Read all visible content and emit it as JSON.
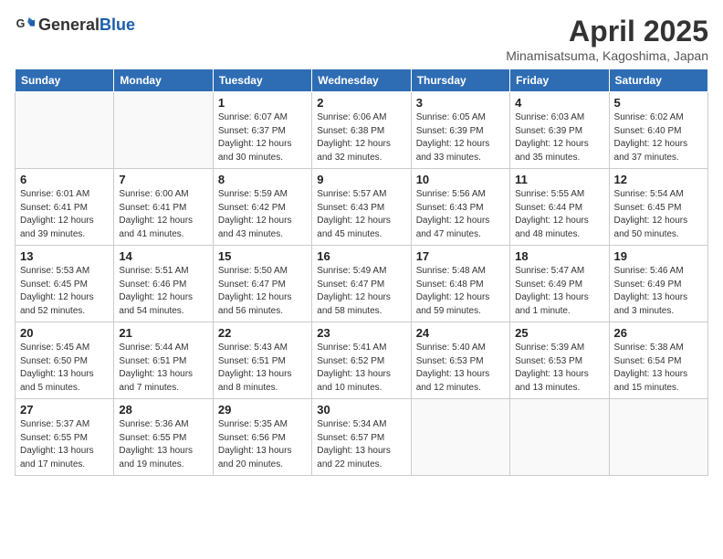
{
  "header": {
    "logo_general": "General",
    "logo_blue": "Blue",
    "title": "April 2025",
    "subtitle": "Minamisatsuma, Kagoshima, Japan"
  },
  "days_of_week": [
    "Sunday",
    "Monday",
    "Tuesday",
    "Wednesday",
    "Thursday",
    "Friday",
    "Saturday"
  ],
  "weeks": [
    [
      {
        "day": "",
        "detail": ""
      },
      {
        "day": "",
        "detail": ""
      },
      {
        "day": "1",
        "detail": "Sunrise: 6:07 AM\nSunset: 6:37 PM\nDaylight: 12 hours\nand 30 minutes."
      },
      {
        "day": "2",
        "detail": "Sunrise: 6:06 AM\nSunset: 6:38 PM\nDaylight: 12 hours\nand 32 minutes."
      },
      {
        "day": "3",
        "detail": "Sunrise: 6:05 AM\nSunset: 6:39 PM\nDaylight: 12 hours\nand 33 minutes."
      },
      {
        "day": "4",
        "detail": "Sunrise: 6:03 AM\nSunset: 6:39 PM\nDaylight: 12 hours\nand 35 minutes."
      },
      {
        "day": "5",
        "detail": "Sunrise: 6:02 AM\nSunset: 6:40 PM\nDaylight: 12 hours\nand 37 minutes."
      }
    ],
    [
      {
        "day": "6",
        "detail": "Sunrise: 6:01 AM\nSunset: 6:41 PM\nDaylight: 12 hours\nand 39 minutes."
      },
      {
        "day": "7",
        "detail": "Sunrise: 6:00 AM\nSunset: 6:41 PM\nDaylight: 12 hours\nand 41 minutes."
      },
      {
        "day": "8",
        "detail": "Sunrise: 5:59 AM\nSunset: 6:42 PM\nDaylight: 12 hours\nand 43 minutes."
      },
      {
        "day": "9",
        "detail": "Sunrise: 5:57 AM\nSunset: 6:43 PM\nDaylight: 12 hours\nand 45 minutes."
      },
      {
        "day": "10",
        "detail": "Sunrise: 5:56 AM\nSunset: 6:43 PM\nDaylight: 12 hours\nand 47 minutes."
      },
      {
        "day": "11",
        "detail": "Sunrise: 5:55 AM\nSunset: 6:44 PM\nDaylight: 12 hours\nand 48 minutes."
      },
      {
        "day": "12",
        "detail": "Sunrise: 5:54 AM\nSunset: 6:45 PM\nDaylight: 12 hours\nand 50 minutes."
      }
    ],
    [
      {
        "day": "13",
        "detail": "Sunrise: 5:53 AM\nSunset: 6:45 PM\nDaylight: 12 hours\nand 52 minutes."
      },
      {
        "day": "14",
        "detail": "Sunrise: 5:51 AM\nSunset: 6:46 PM\nDaylight: 12 hours\nand 54 minutes."
      },
      {
        "day": "15",
        "detail": "Sunrise: 5:50 AM\nSunset: 6:47 PM\nDaylight: 12 hours\nand 56 minutes."
      },
      {
        "day": "16",
        "detail": "Sunrise: 5:49 AM\nSunset: 6:47 PM\nDaylight: 12 hours\nand 58 minutes."
      },
      {
        "day": "17",
        "detail": "Sunrise: 5:48 AM\nSunset: 6:48 PM\nDaylight: 12 hours\nand 59 minutes."
      },
      {
        "day": "18",
        "detail": "Sunrise: 5:47 AM\nSunset: 6:49 PM\nDaylight: 13 hours\nand 1 minute."
      },
      {
        "day": "19",
        "detail": "Sunrise: 5:46 AM\nSunset: 6:49 PM\nDaylight: 13 hours\nand 3 minutes."
      }
    ],
    [
      {
        "day": "20",
        "detail": "Sunrise: 5:45 AM\nSunset: 6:50 PM\nDaylight: 13 hours\nand 5 minutes."
      },
      {
        "day": "21",
        "detail": "Sunrise: 5:44 AM\nSunset: 6:51 PM\nDaylight: 13 hours\nand 7 minutes."
      },
      {
        "day": "22",
        "detail": "Sunrise: 5:43 AM\nSunset: 6:51 PM\nDaylight: 13 hours\nand 8 minutes."
      },
      {
        "day": "23",
        "detail": "Sunrise: 5:41 AM\nSunset: 6:52 PM\nDaylight: 13 hours\nand 10 minutes."
      },
      {
        "day": "24",
        "detail": "Sunrise: 5:40 AM\nSunset: 6:53 PM\nDaylight: 13 hours\nand 12 minutes."
      },
      {
        "day": "25",
        "detail": "Sunrise: 5:39 AM\nSunset: 6:53 PM\nDaylight: 13 hours\nand 13 minutes."
      },
      {
        "day": "26",
        "detail": "Sunrise: 5:38 AM\nSunset: 6:54 PM\nDaylight: 13 hours\nand 15 minutes."
      }
    ],
    [
      {
        "day": "27",
        "detail": "Sunrise: 5:37 AM\nSunset: 6:55 PM\nDaylight: 13 hours\nand 17 minutes."
      },
      {
        "day": "28",
        "detail": "Sunrise: 5:36 AM\nSunset: 6:55 PM\nDaylight: 13 hours\nand 19 minutes."
      },
      {
        "day": "29",
        "detail": "Sunrise: 5:35 AM\nSunset: 6:56 PM\nDaylight: 13 hours\nand 20 minutes."
      },
      {
        "day": "30",
        "detail": "Sunrise: 5:34 AM\nSunset: 6:57 PM\nDaylight: 13 hours\nand 22 minutes."
      },
      {
        "day": "",
        "detail": ""
      },
      {
        "day": "",
        "detail": ""
      },
      {
        "day": "",
        "detail": ""
      }
    ]
  ]
}
